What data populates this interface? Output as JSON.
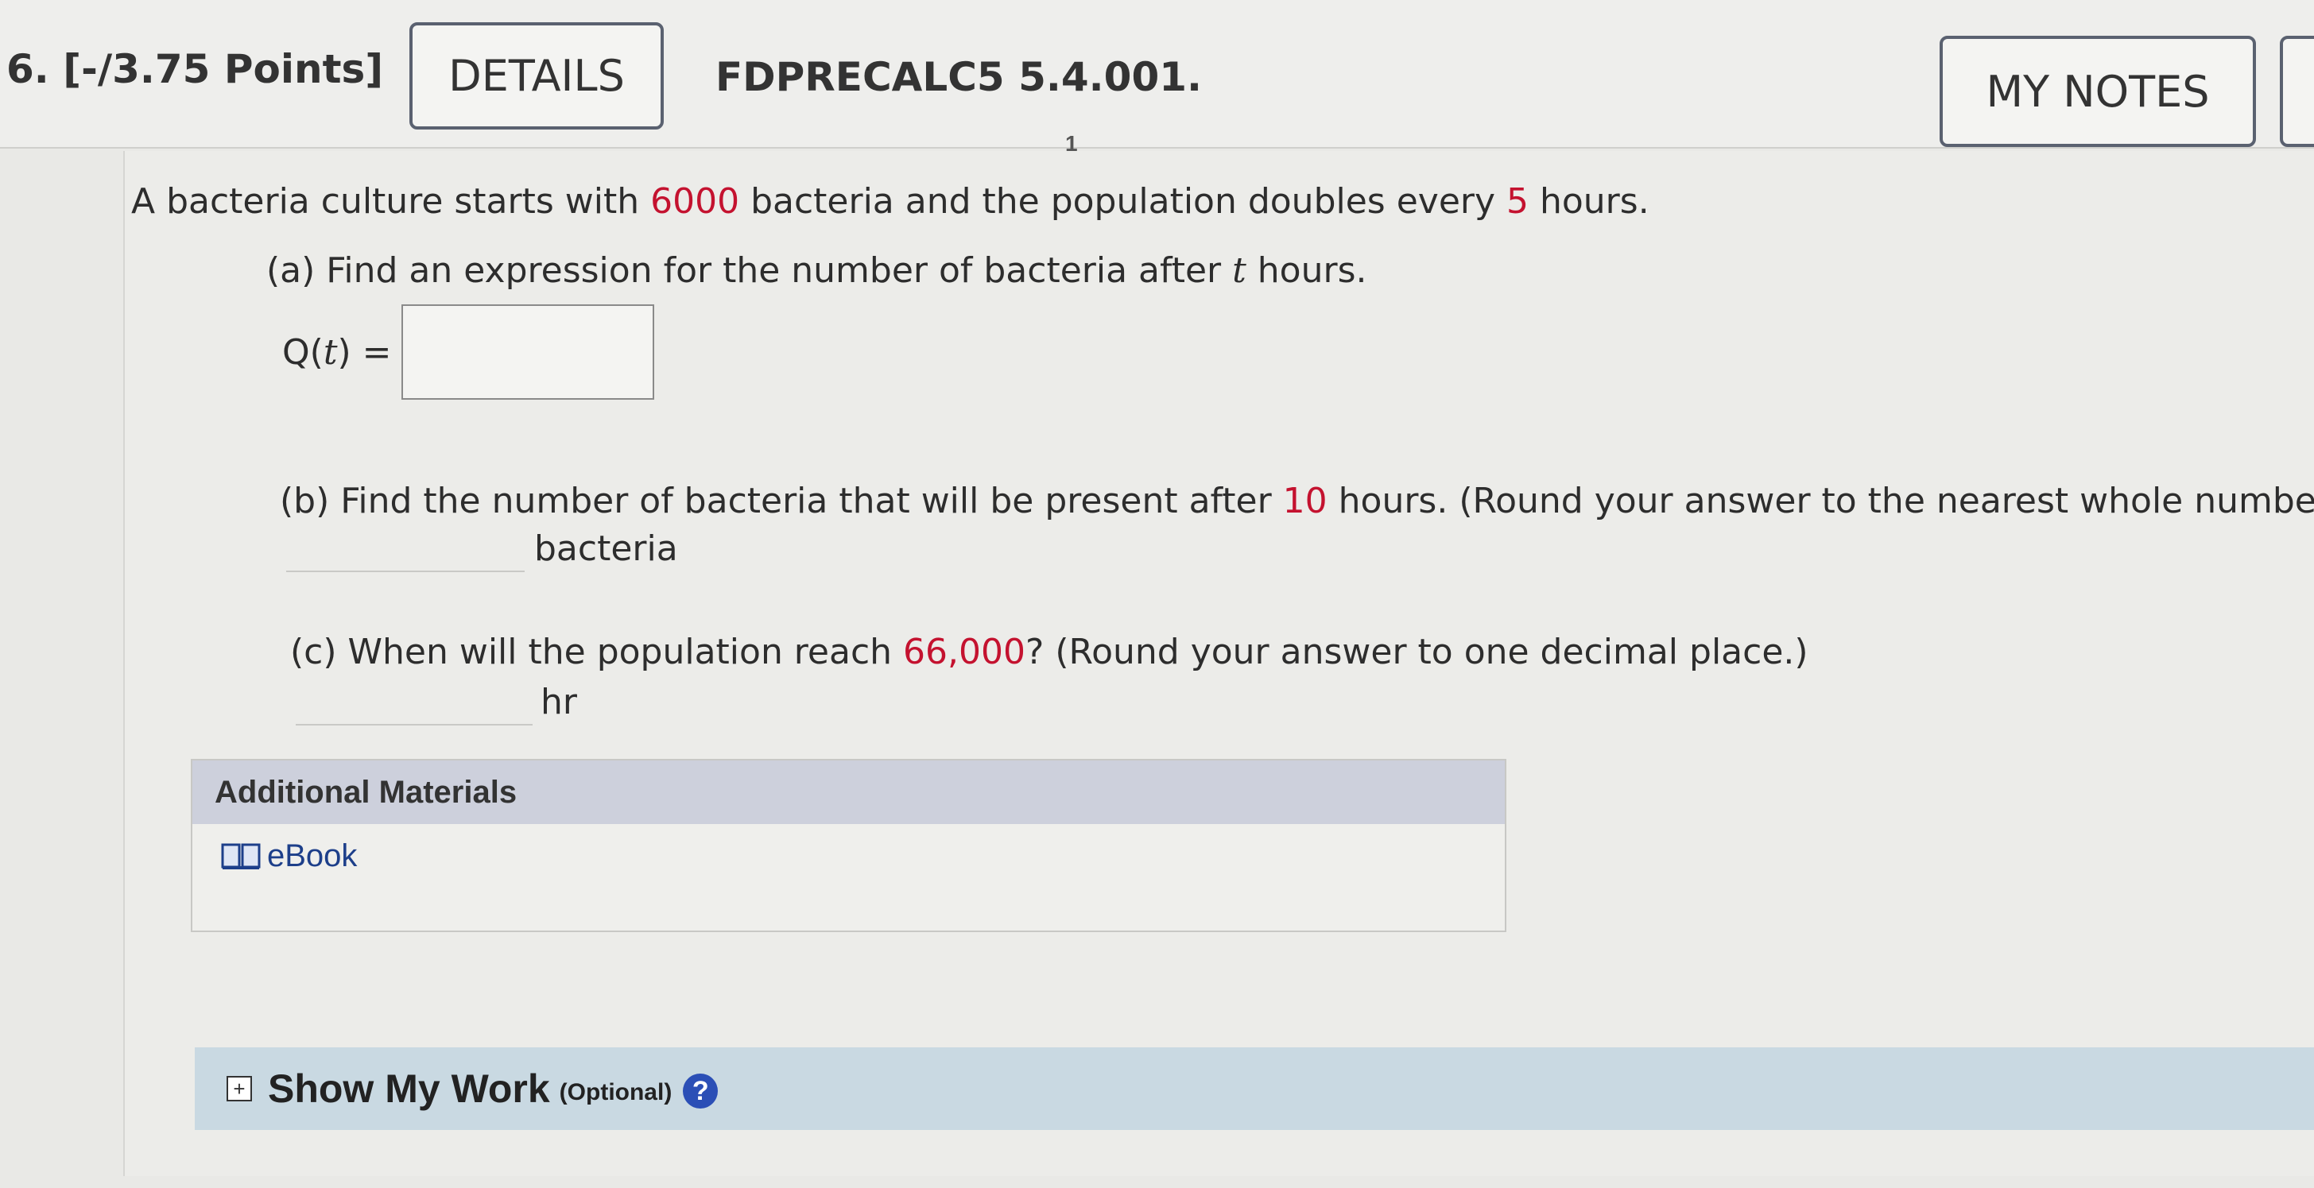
{
  "header": {
    "question_number": "6.",
    "points": "[-/3.75 Points]",
    "details_label": "DETAILS",
    "problem_id": "FDPRECALC5 5.4.001.",
    "my_notes_label": "MY NOTES",
    "stray_mark": "1"
  },
  "problem": {
    "intro_pre": "A bacteria culture starts with ",
    "intro_start": "6000",
    "intro_mid": " bacteria and the population doubles every ",
    "intro_period": "5",
    "intro_post": " hours.",
    "part_a_pre": "(a) Find an expression for the number of bacteria after ",
    "part_a_var": "t",
    "part_a_post": " hours.",
    "qt_label_pre": "Q(",
    "qt_var": "t",
    "qt_label_post": ") =",
    "part_b_pre": "(b) Find the number of bacteria that will be present after ",
    "part_b_hours": "10",
    "part_b_post": " hours. (Round your answer to the nearest whole number.)",
    "part_b_unit": "bacteria",
    "part_c_pre": "(c) When will the population reach ",
    "part_c_value": "66,000",
    "part_c_post": "? (Round your answer to one decimal place.)",
    "part_c_unit": "hr"
  },
  "materials": {
    "heading": "Additional Materials",
    "ebook_label": "eBook"
  },
  "show_work": {
    "label": "Show My Work",
    "optional": "(Optional)",
    "help": "?"
  },
  "colors": {
    "accent_red": "#c4122f",
    "link_blue": "#1d3f8a",
    "materials_header": "#cdd0dc",
    "show_work_bar": "#c9d9e2"
  }
}
